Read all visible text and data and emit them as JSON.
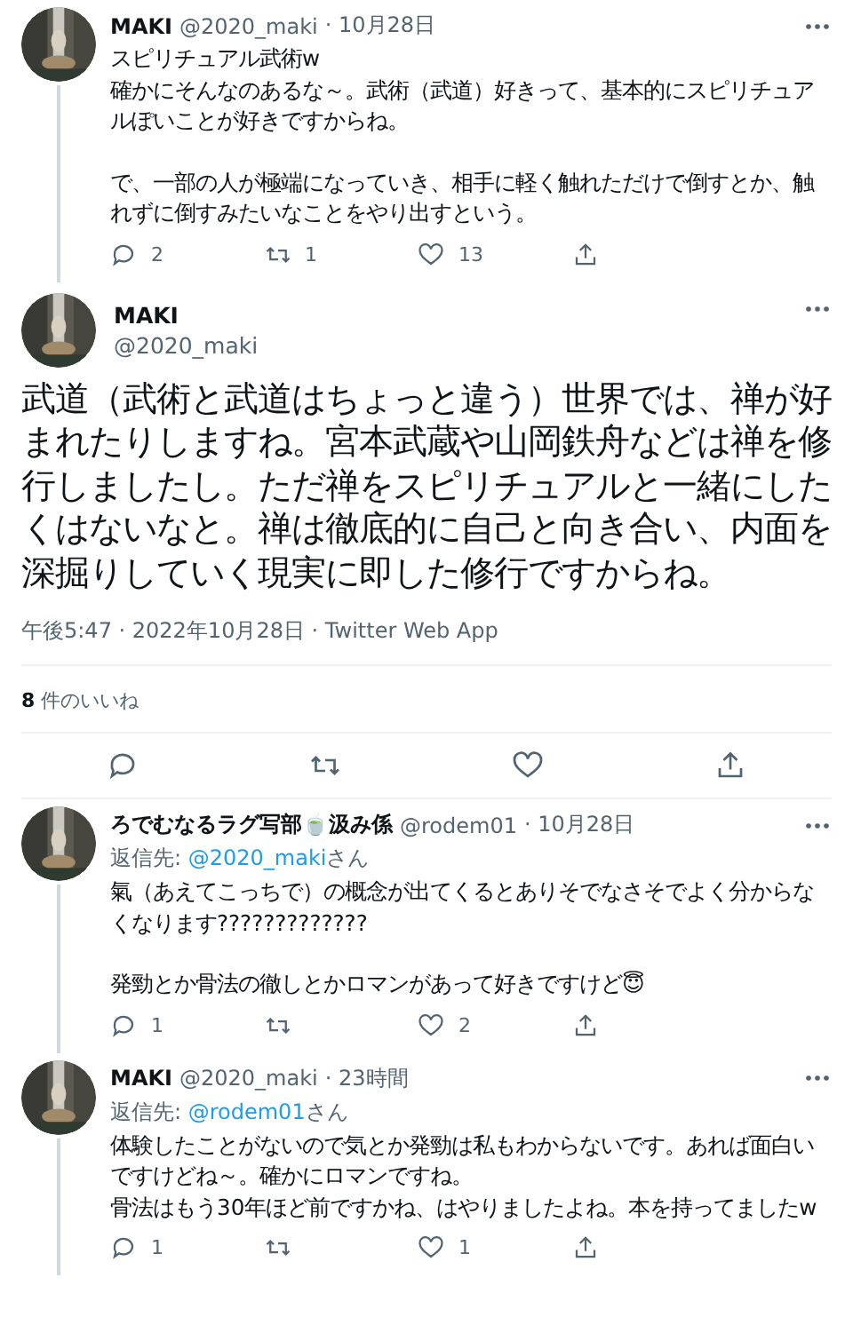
{
  "tweets": [
    {
      "kind": "compact",
      "name": "MAKI",
      "handle": "@2020_maki",
      "time": "· 10月28日",
      "thread_line": true,
      "paragraphs": [
        [
          "スピリチュアル武術w",
          "確かにそんなのあるな～。武術（武道）好きって、基本的にスピリチュアルぽいことが好きですからね。"
        ],
        [
          "で、一部の人が極端になっていき、相手に軽く触れただけで倒すとか、触れずに倒すみたいなことをやり出すという。"
        ]
      ],
      "actions": [
        {
          "kind": "reply",
          "count": "2"
        },
        {
          "kind": "retweet",
          "count": "1"
        },
        {
          "kind": "like",
          "count": "13"
        },
        {
          "kind": "share"
        }
      ]
    },
    {
      "kind": "main",
      "name": "MAKI",
      "handle": "@2020_maki",
      "body": "武道（武術と武道はちょっと違う）世界では、禅が好まれたりしますね。宮本武蔵や山岡鉄舟などは禅を修行しましたし。ただ禅をスピリチュアルと一緒にしたくはないなと。禅は徹底的に自己と向き合い、内面を深掘りしていく現実に即した修行ですからね。",
      "meta": "午後5:47 · 2022年10月28日 · Twitter Web App",
      "likes": {
        "count": "8",
        "label": "件のいいね"
      },
      "actions": [
        {
          "kind": "reply"
        },
        {
          "kind": "retweet"
        },
        {
          "kind": "like"
        },
        {
          "kind": "share"
        }
      ]
    },
    {
      "kind": "compact",
      "name": "ろでむなるラグ写部🍵汲み係",
      "handle": "@rodem01",
      "time": "· 10月28日",
      "thread_line": true,
      "reply_to": {
        "prefix": "返信先: ",
        "handle": "@2020_maki",
        "suffix": "さん"
      },
      "paragraphs": [
        [
          "氣（あえてこっちで）の概念が出てくるとありそでなさそでよく分からなくなります?????????????"
        ],
        [
          "発勁とか骨法の徹しとかロマンがあって好きですけど😇"
        ]
      ],
      "actions": [
        {
          "kind": "reply",
          "count": "1"
        },
        {
          "kind": "retweet"
        },
        {
          "kind": "like",
          "count": "2"
        },
        {
          "kind": "share"
        }
      ]
    },
    {
      "kind": "compact",
      "name": "MAKI",
      "handle": "@2020_maki",
      "time": "· 23時間",
      "thread_line": true,
      "reply_to": {
        "prefix": "返信先: ",
        "handle": "@rodem01",
        "suffix": "さん"
      },
      "paragraphs": [
        [
          "体験したことがないので気とか発勁は私もわからないです。あれば面白いですけどね～。確かにロマンですね。",
          "骨法はもう30年ほど前ですかね、はやりましたよね。本を持ってましたw"
        ]
      ],
      "actions": [
        {
          "kind": "reply",
          "count": "1"
        },
        {
          "kind": "retweet"
        },
        {
          "kind": "like",
          "count": "1"
        },
        {
          "kind": "share"
        }
      ]
    }
  ]
}
